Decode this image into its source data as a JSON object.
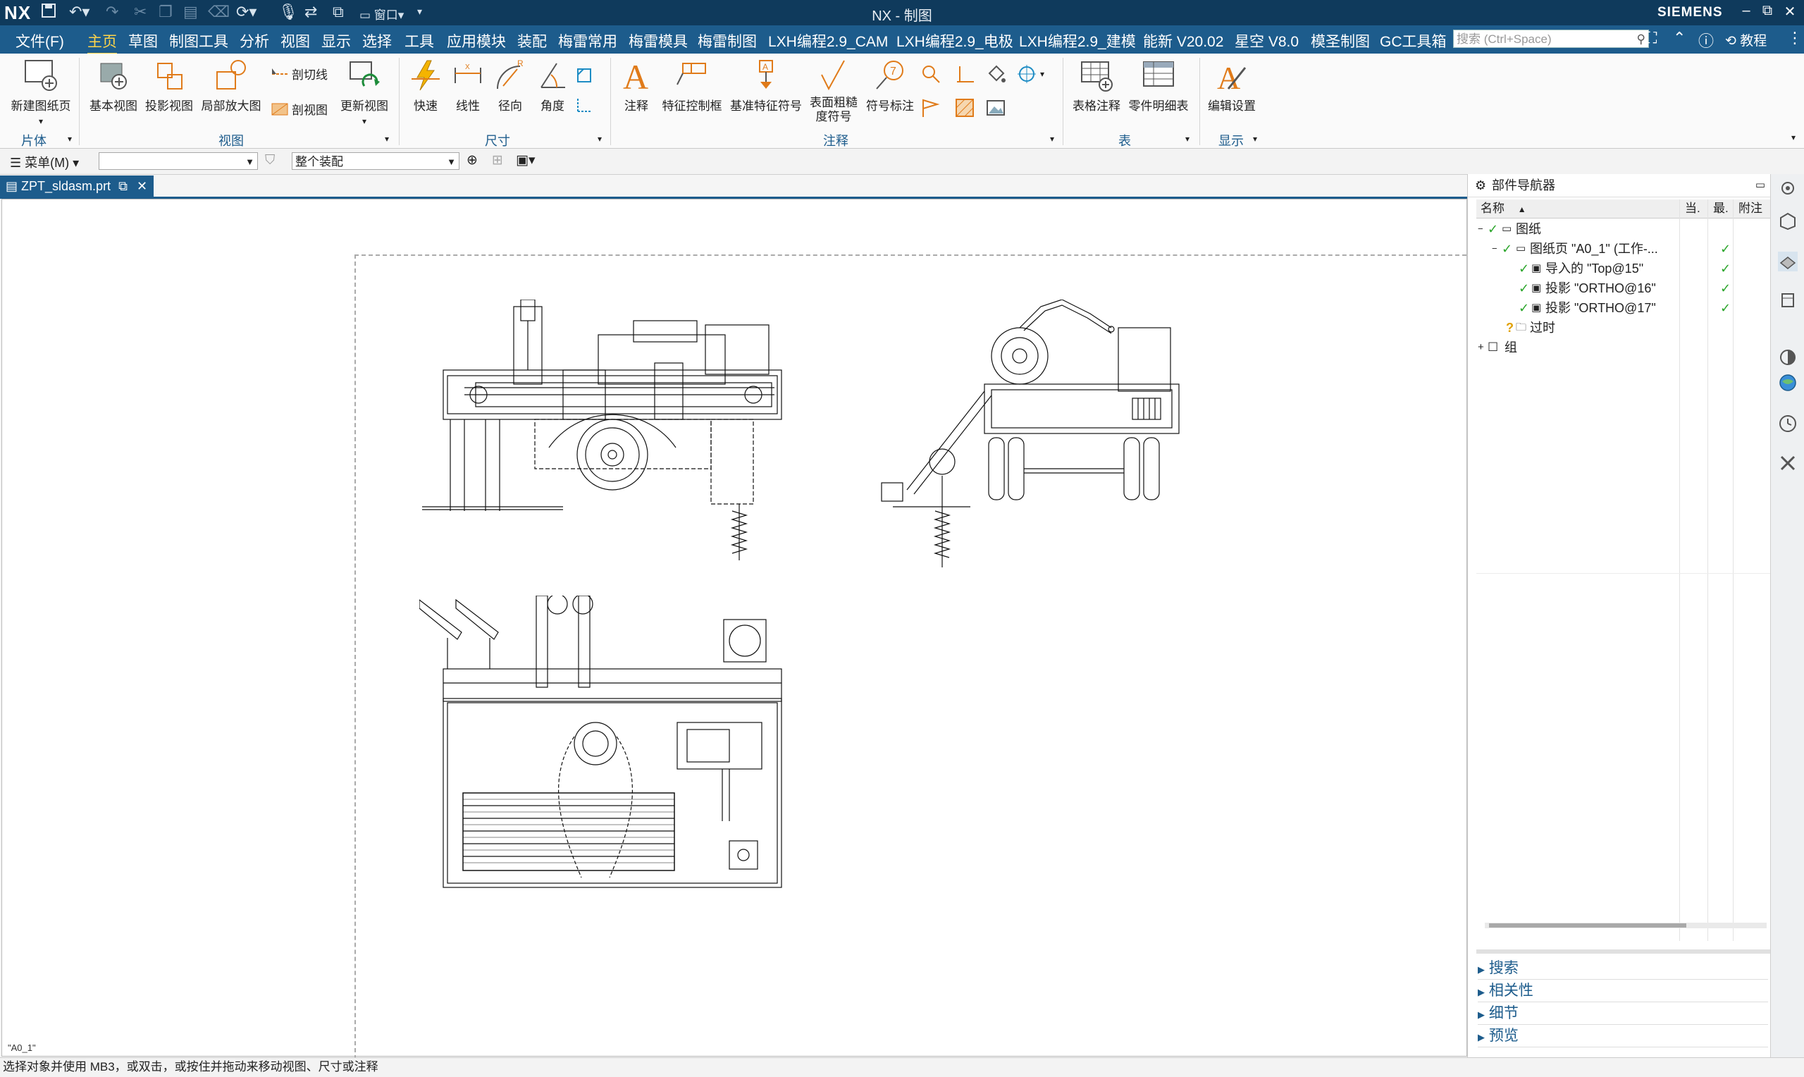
{
  "titlebar": {
    "logo": "NX",
    "window_title": "NX - 制图",
    "brand": "SIEMENS",
    "window_menu_label": "窗口"
  },
  "menubar": {
    "file": "文件(F)",
    "tabs": [
      "主页",
      "草图",
      "制图工具",
      "分析",
      "视图",
      "显示",
      "选择",
      "工具",
      "应用模块",
      "装配",
      "梅雷常用",
      "梅雷模具",
      "梅雷制图",
      "LXH编程2.9_CAM",
      "LXH编程2.9_电极",
      "LXH编程2.9_建模",
      "能新 V20.02",
      "星空 V8.0",
      "模圣制图",
      "GC工具箱"
    ],
    "active_tab": "主页",
    "search_placeholder": "搜索 (Ctrl+Space)",
    "tutorial": "教程"
  },
  "ribbon": {
    "new_sheet": "新建图纸页",
    "base_view": "基本视图",
    "projected_view": "投影视图",
    "detail_view": "局部放大图",
    "section_line": "剖切线",
    "section_view": "剖视图",
    "update_view": "更新视图",
    "rapid": "快速",
    "linear": "线性",
    "radial": "径向",
    "angular": "角度",
    "note": "注释",
    "fcf": "特征控制框",
    "datum": "基准特征符号",
    "surface_finish_1": "表面粗糙",
    "surface_finish_2": "度符号",
    "id_symbol": "符号标注",
    "table_note": "表格注释",
    "parts_list": "零件明细表",
    "edit_settings": "编辑设置",
    "groups": {
      "sheet": "片体",
      "view": "视图",
      "dimension": "尺寸",
      "annotation": "注释",
      "table": "表",
      "display": "显示"
    }
  },
  "toolbar2": {
    "menu_label": "菜单(M)",
    "filter_value": "",
    "assembly_scope": "整个装配"
  },
  "document": {
    "tab_name": "ZPT_sldasm.prt",
    "sheet_label": "\"A0_1\""
  },
  "navigator": {
    "title": "部件导航器",
    "columns": [
      "名称",
      "当.",
      "最.",
      "附注"
    ],
    "tree": [
      {
        "label": "图纸",
        "level": 0,
        "expander": "−",
        "check": true,
        "icon": "sheet-folder-icon",
        "latest": false
      },
      {
        "label": "图纸页 \"A0_1\" (工作-...",
        "level": 1,
        "expander": "−",
        "check": true,
        "icon": "sheet-icon",
        "latest": true
      },
      {
        "label": "导入的 \"Top@15\"",
        "level": 2,
        "expander": "",
        "check": true,
        "icon": "view-icon",
        "latest": true
      },
      {
        "label": "投影 \"ORTHO@16\"",
        "level": 2,
        "expander": "",
        "check": true,
        "icon": "view-icon",
        "latest": true
      },
      {
        "label": "投影 \"ORTHO@17\"",
        "level": 2,
        "expander": "",
        "check": true,
        "icon": "view-icon",
        "latest": true
      },
      {
        "label": "过时",
        "level": 1,
        "expander": "",
        "check": false,
        "icon": "folder-icon",
        "latest": false
      },
      {
        "label": "组",
        "level": 0,
        "expander": "+",
        "check": false,
        "icon": "group-icon",
        "latest": false
      }
    ],
    "accordion": [
      "搜索",
      "相关性",
      "细节",
      "预览"
    ]
  },
  "status": {
    "message": "选择对象并使用 MB3，或双击，或按住并拖动来移动视图、尺寸或注释"
  },
  "colors": {
    "title_bg": "#0f3a5c",
    "menu_bg": "#1d5c8c",
    "active_tab": "#ffd54a",
    "accent_orange": "#e07b1a",
    "check_green": "#2aa52a"
  }
}
